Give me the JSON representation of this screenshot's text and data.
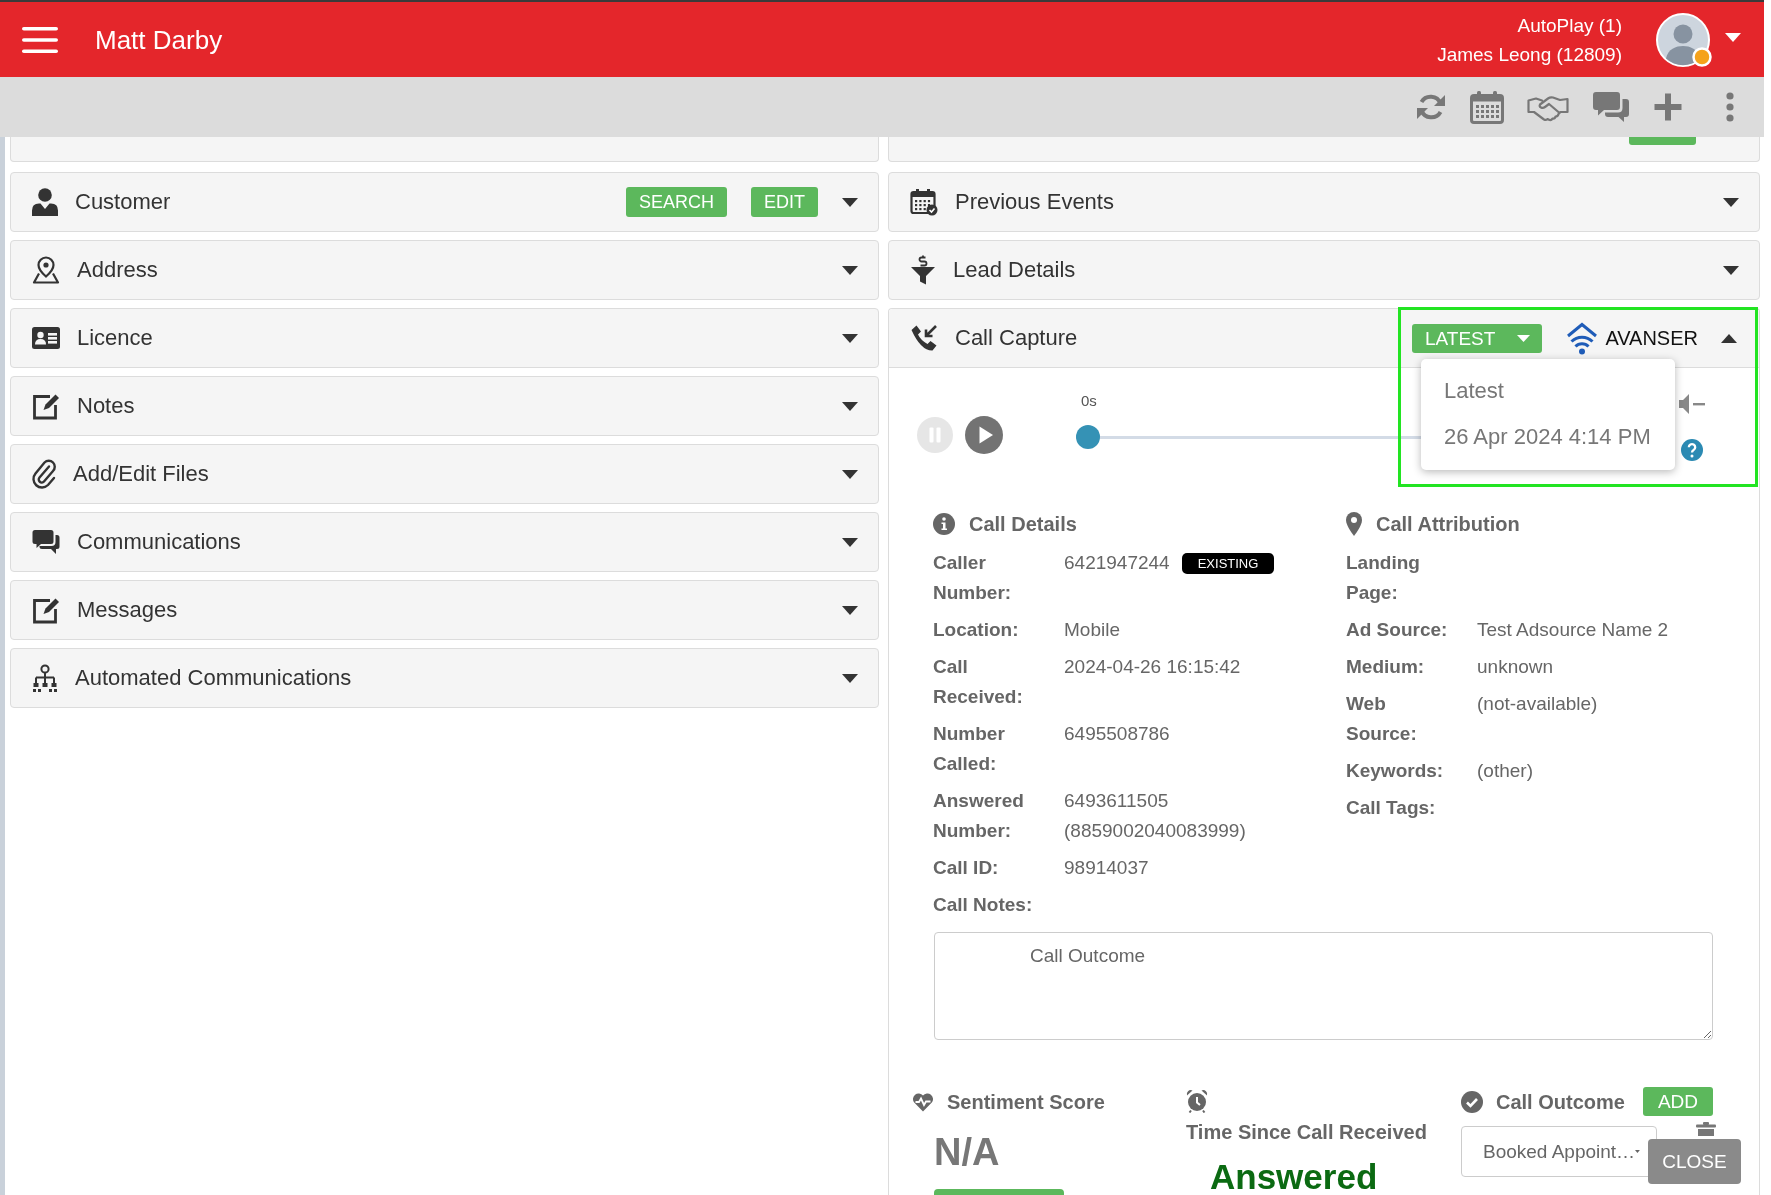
{
  "header": {
    "title": "Matt Darby",
    "account_lines": [
      "AutoPlay (1)",
      "James Leong (12809)"
    ]
  },
  "left_panels": [
    {
      "kind": "clipped",
      "has_button": false
    },
    {
      "kind": "section",
      "title": "Customer",
      "buttons": [
        "SEARCH",
        "EDIT"
      ],
      "expanded": false
    },
    {
      "kind": "section",
      "title": "Address",
      "expanded": false
    },
    {
      "kind": "section",
      "title": "Licence",
      "expanded": false
    },
    {
      "kind": "section",
      "title": "Notes",
      "expanded": false
    },
    {
      "kind": "section",
      "title": "Add/Edit Files",
      "expanded": false
    },
    {
      "kind": "section",
      "title": "Communications",
      "expanded": false
    },
    {
      "kind": "section",
      "title": "Messages",
      "expanded": false
    },
    {
      "kind": "section",
      "title": "Automated Communications",
      "expanded": false
    }
  ],
  "right_panels": [
    {
      "kind": "clipped",
      "has_button": true
    },
    {
      "kind": "section",
      "title": "Previous Events",
      "expanded": false
    },
    {
      "kind": "section",
      "title": "Lead Details",
      "expanded": false
    }
  ],
  "call_capture": {
    "title": "Call Capture",
    "expanded": true,
    "highlighted": true,
    "recording_button": "LATEST",
    "provider": "AVANSER",
    "recording_menu": {
      "open": true,
      "items": [
        "Latest",
        "26 Apr 2024 4:14 PM"
      ]
    },
    "player": {
      "time": "0s",
      "level": 0,
      "playing": false
    },
    "details": {
      "title": "Call Details",
      "rows": [
        {
          "label": "Caller Number:",
          "value": "6421947244",
          "badge": "EXISTING"
        },
        {
          "label": "Location:",
          "value": "Mobile"
        },
        {
          "label": "Call Received:",
          "value": "2024-04-26 16:15:42"
        },
        {
          "label": "Number Called:",
          "value": "6495508786"
        },
        {
          "label": "Answered Number:",
          "value": "6493611505 (8859002040083999)"
        },
        {
          "label": "Call ID:",
          "value": "98914037"
        }
      ],
      "notes_label": "Call Notes:"
    },
    "attribution": {
      "title": "Call Attribution",
      "rows": [
        {
          "label": "Landing Page:"
        },
        {
          "label": "Ad Source:",
          "value": "Test Adsource Name 2"
        },
        {
          "label": "Medium:",
          "value": "unknown"
        },
        {
          "label": "Web Source:",
          "value": "(not-available)"
        },
        {
          "label": "Keywords:",
          "value": "(other)"
        },
        {
          "label": "Call Tags:"
        }
      ]
    },
    "notes": {
      "value": "Call Outcome"
    },
    "sentiment": {
      "title": "Sentiment Score",
      "value": "N/A"
    },
    "time_since": {
      "title": "Time Since Call Received",
      "value": "Answered"
    },
    "outcome": {
      "title": "Call Outcome",
      "add_button": "ADD",
      "value": "Booked Appoint…"
    }
  },
  "close_button": "CLOSE"
}
